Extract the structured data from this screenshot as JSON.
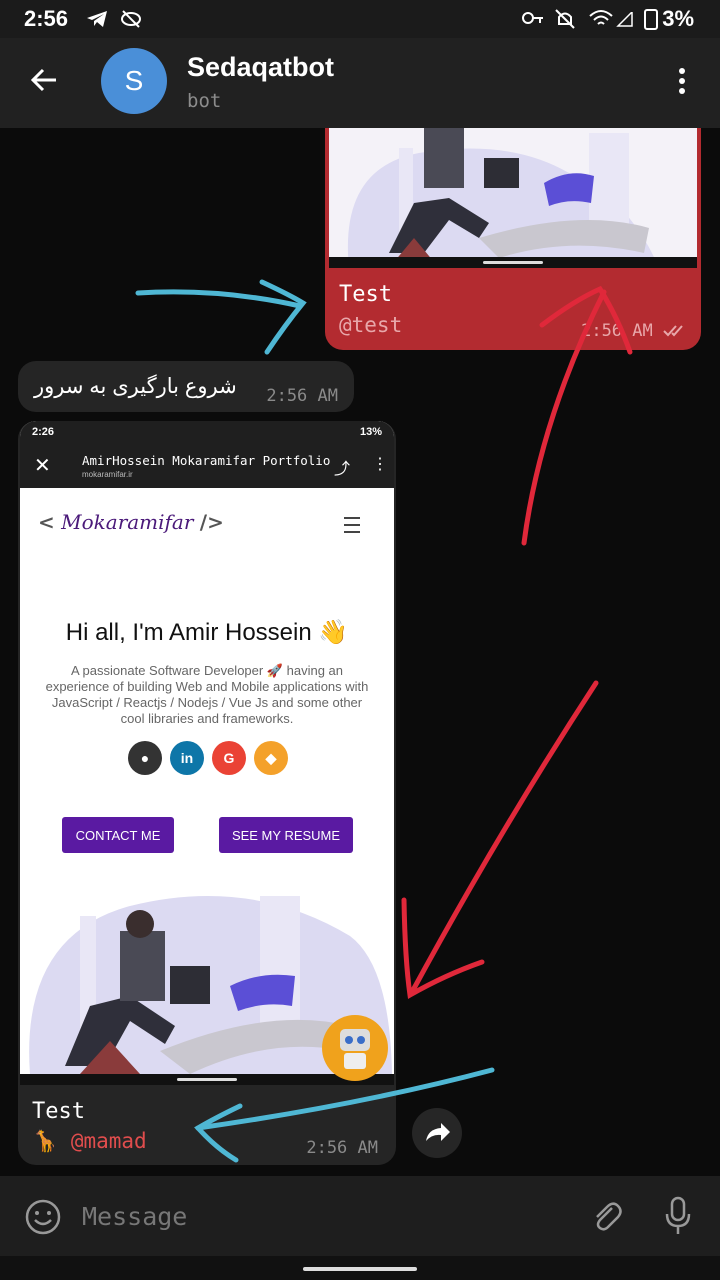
{
  "status_bar": {
    "time": "2:56",
    "battery": "3%"
  },
  "header": {
    "title": "Sedaqatbot",
    "subtitle": "bot",
    "avatar_letter": "S"
  },
  "messages": {
    "top": {
      "caption": "Test",
      "username": "@test",
      "time": "2:56 AM"
    },
    "text": {
      "text": "شروع بارگیری به سرور",
      "time": "2:56 AM"
    },
    "big": {
      "caption": "Test",
      "username": "@mamad",
      "user_emoji": "🦒",
      "time": "2:56 AM"
    }
  },
  "screenshot": {
    "status_time": "2:26",
    "status_battery": "13%",
    "url_title": "AmirHossein Mokaramifar Portfolio",
    "url_domain": "mokaramifar.ir",
    "logo_open": "<",
    "logo_text": "Mokaramifar",
    "logo_close": "/>",
    "hero": "Hi all, I'm Amir Hossein 👋",
    "description": "A passionate Software Developer 🚀 having an experience of building Web and Mobile applications with JavaScript / Reactjs / Nodejs / Vue Js and some other cool libraries and frameworks.",
    "social_in": "in",
    "social_g": "G",
    "contact_button": "CONTACT ME",
    "resume_button": "SEE MY RESUME"
  },
  "input": {
    "placeholder": "Message"
  },
  "colors": {
    "bubble_out": "#b32b30",
    "bubble_in": "#252525",
    "accent": "#5a1aa2",
    "arrow_red": "#e0283a",
    "arrow_blue": "#4fb7d4"
  }
}
